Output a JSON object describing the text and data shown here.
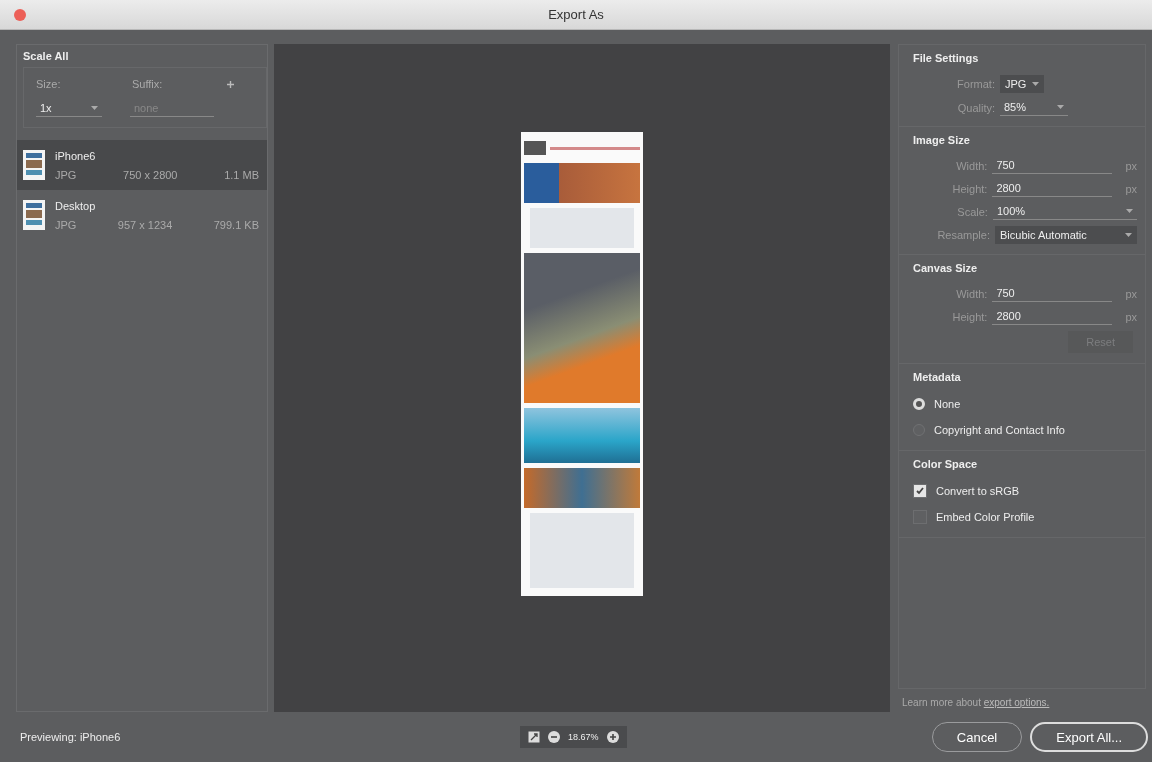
{
  "window": {
    "title": "Export As"
  },
  "scale_all": {
    "title": "Scale All",
    "size_label": "Size:",
    "suffix_label": "Suffix:",
    "size_value": "1x",
    "suffix_placeholder": "none"
  },
  "assets": [
    {
      "name": "iPhone6",
      "format": "JPG",
      "dimensions": "750 x 2800",
      "file_size": "1.1 MB",
      "selected": true
    },
    {
      "name": "Desktop",
      "format": "JPG",
      "dimensions": "957 x 1234",
      "file_size": "799.1 KB",
      "selected": false
    }
  ],
  "file_settings": {
    "title": "File Settings",
    "format_label": "Format:",
    "format_value": "JPG",
    "quality_label": "Quality:",
    "quality_value": "85%"
  },
  "image_size": {
    "title": "Image Size",
    "width_label": "Width:",
    "width_value": "750",
    "width_unit": "px",
    "height_label": "Height:",
    "height_value": "2800",
    "height_unit": "px",
    "scale_label": "Scale:",
    "scale_value": "100%",
    "resample_label": "Resample:",
    "resample_value": "Bicubic Automatic"
  },
  "canvas_size": {
    "title": "Canvas Size",
    "width_label": "Width:",
    "width_value": "750",
    "width_unit": "px",
    "height_label": "Height:",
    "height_value": "2800",
    "height_unit": "px",
    "reset_button": "Reset",
    "reset_disabled": true
  },
  "metadata": {
    "title": "Metadata",
    "options": [
      {
        "label": "None",
        "selected": true
      },
      {
        "label": "Copyright and Contact Info",
        "selected": false
      }
    ]
  },
  "color_space": {
    "title": "Color Space",
    "options": [
      {
        "label": "Convert to sRGB",
        "checked": true
      },
      {
        "label": "Embed Color Profile",
        "checked": false
      }
    ]
  },
  "learn_more": {
    "text": "Learn more about",
    "link": "export options."
  },
  "buttons": {
    "cancel": "Cancel",
    "export": "Export All..."
  },
  "status_bar": {
    "previewing": "Previewing: iPhone6",
    "zoom": "18.67%"
  }
}
